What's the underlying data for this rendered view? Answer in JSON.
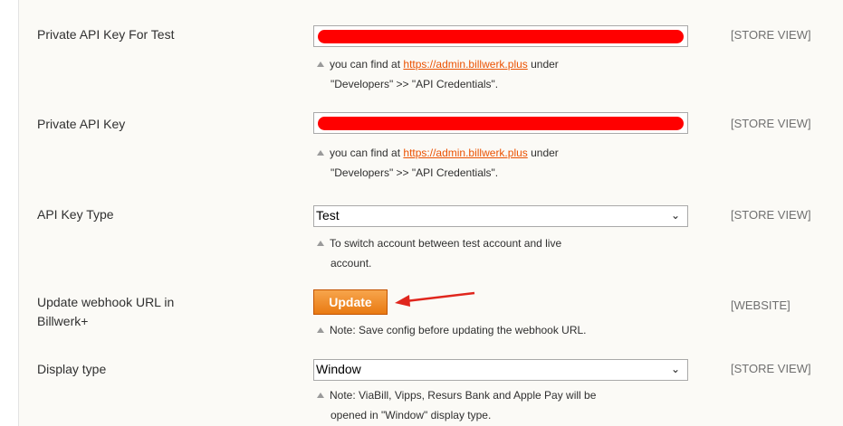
{
  "rows": [
    {
      "label": "Private API Key For Test",
      "scope": "[STORE VIEW]",
      "note_prefix": "you can find at ",
      "note_link": "https://admin.billwerk.plus",
      "note_suffix": " under",
      "note_line2": "\"Developers\" >> \"API Credentials\"."
    },
    {
      "label": "Private API Key",
      "scope": "[STORE VIEW]",
      "note_prefix": "you can find at ",
      "note_link": "https://admin.billwerk.plus",
      "note_suffix": " under",
      "note_line2": "\"Developers\" >> \"API Credentials\"."
    },
    {
      "label": "API Key Type",
      "scope": "[STORE VIEW]",
      "value": "Test",
      "note_line1": "To switch account between test account and live",
      "note_line2": "account."
    },
    {
      "label_line1": "Update webhook URL in",
      "label_line2": "Billwerk+",
      "scope": "[WEBSITE]",
      "button": "Update",
      "note_line1": "Note: Save config before updating the webhook URL."
    },
    {
      "label": "Display type",
      "scope": "[STORE VIEW]",
      "value": "Window",
      "note_line1": "Note: ViaBill, Vipps, Resurs Bank and Apple Pay will be",
      "note_line2": "opened in \"Window\" display type."
    }
  ],
  "icons": {
    "select_chevron": "chevron-down-icon",
    "note_marker": "triangle-up-icon",
    "annotation": "red-arrow"
  },
  "colors": {
    "redaction": "#ff0000",
    "link": "#eb5202",
    "button": "#eb8a1f",
    "arrow": "#e0261d"
  }
}
